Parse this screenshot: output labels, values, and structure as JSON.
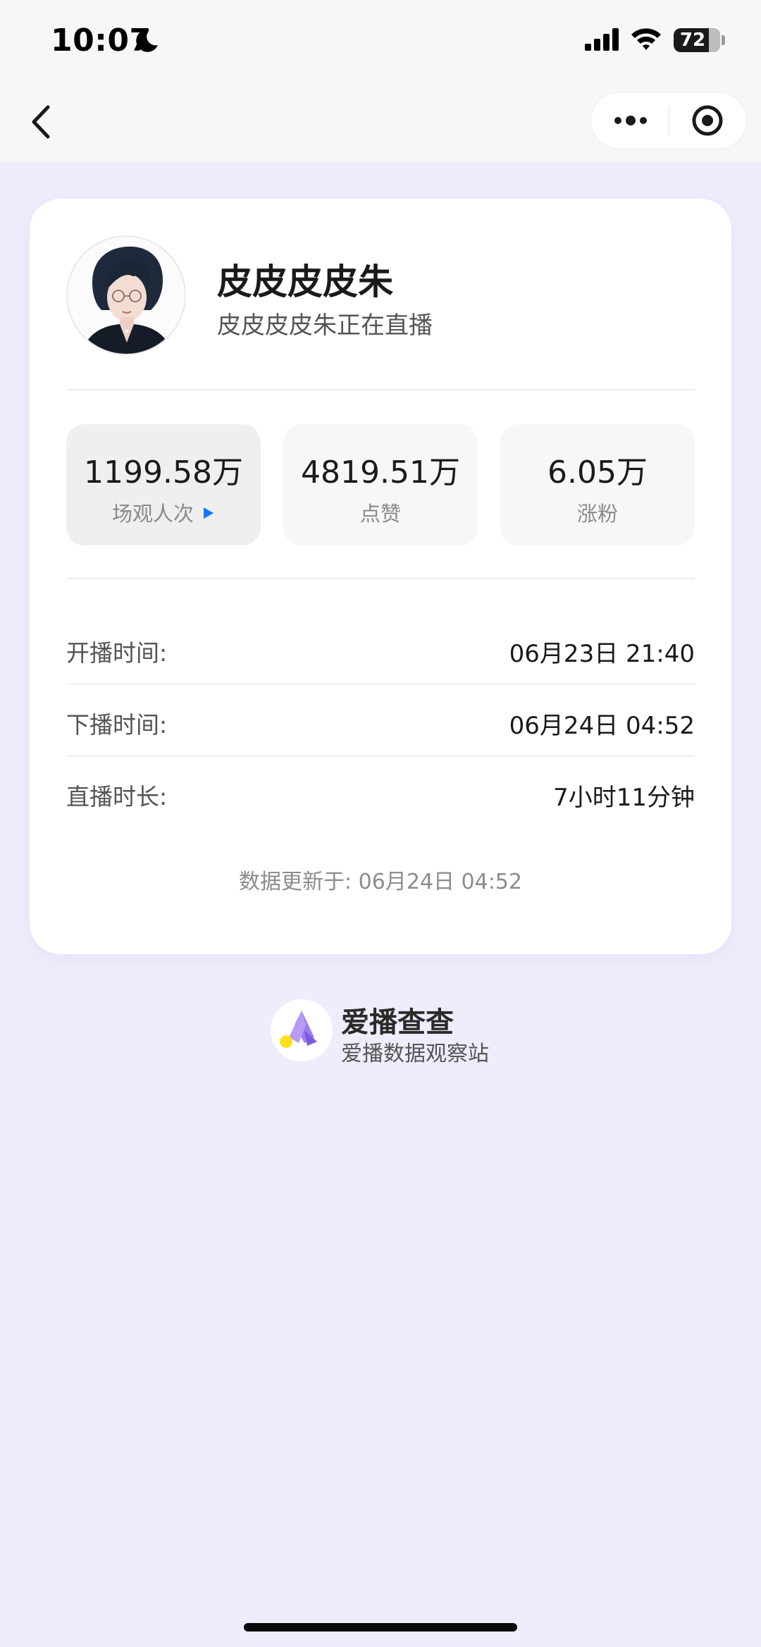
{
  "status_bar": {
    "time": "10:07",
    "battery": "72"
  },
  "nav": {
    "back_icon": "chevron-left-icon",
    "more_icon": "more-dots-icon",
    "close_icon": "target-icon"
  },
  "profile": {
    "name": "皮皮皮皮朱",
    "subtitle": "皮皮皮皮朱正在直播"
  },
  "stats": [
    {
      "value": "1199.58万",
      "label": "场观人次",
      "active": true
    },
    {
      "value": "4819.51万",
      "label": "点赞"
    },
    {
      "value": "6.05万",
      "label": "涨粉"
    }
  ],
  "details": [
    {
      "label": "开播时间:",
      "value": "06月23日 21:40"
    },
    {
      "label": "下播时间:",
      "value": "06月24日 04:52"
    },
    {
      "label": "直播时长:",
      "value": "7小时11分钟"
    }
  ],
  "update_text": "数据更新于: 06月24日 04:52",
  "brand": {
    "name": "爱播查查",
    "tagline": "爱播数据观察站"
  },
  "colors": {
    "page_background": "#eeedfc",
    "accent_blue": "#1677ff",
    "logo_purple": "#9b7cf0",
    "logo_yellow": "#ffe11a"
  }
}
